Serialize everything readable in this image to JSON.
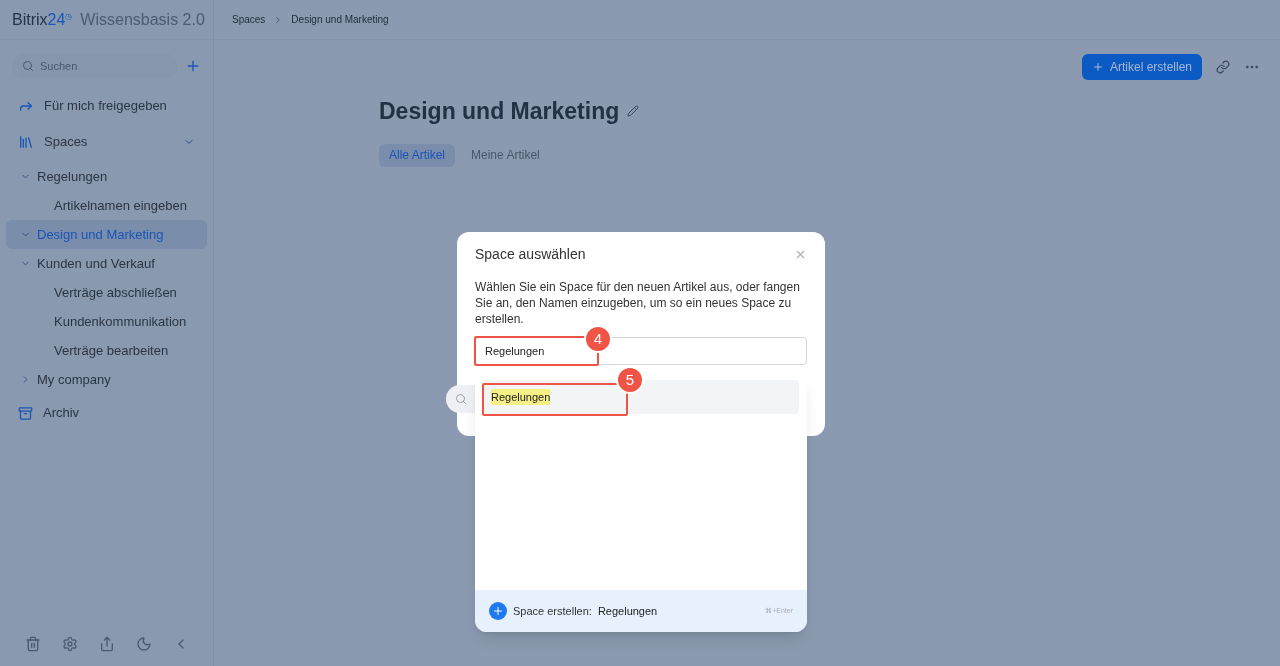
{
  "sidebar": {
    "logo": {
      "brand": "Bitrix",
      "number": "24",
      "mark": "◷"
    },
    "app_title": "Wissensbasis 2.0",
    "search": {
      "placeholder": "Suchen"
    },
    "nav": [
      {
        "kind": "link",
        "label": "Für mich freigegeben"
      },
      {
        "kind": "section",
        "label": "Spaces",
        "expanded": true
      }
    ],
    "tree": [
      {
        "label": "Regelungen",
        "expanded": true,
        "selected": false,
        "children": [
          {
            "label": "Artikelnamen eingeben",
            "selected": false
          }
        ]
      },
      {
        "label": "Design und Marketing",
        "expanded": true,
        "selected": true
      },
      {
        "label": "Kunden und Verkauf",
        "expanded": true,
        "selected": false,
        "children": [
          {
            "label": "Verträge abschließen",
            "selected": false
          },
          {
            "label": "Kundenkommunikation",
            "selected": false
          },
          {
            "label": "Verträge bearbeiten",
            "selected": false
          }
        ]
      },
      {
        "label": "My company",
        "expanded": false,
        "selected": false
      }
    ],
    "archive": "Archiv"
  },
  "breadcrumb": [
    "Spaces",
    "Design und Marketing"
  ],
  "create_button": "Artikel erstellen",
  "page": {
    "title": "Design und Marketing",
    "tabs": [
      {
        "label": "Alle Artikel",
        "selected": true
      },
      {
        "label": "Meine Artikel",
        "selected": false
      }
    ]
  },
  "dialog": {
    "title": "Space auswählen",
    "text": "Wählen Sie ein Space für den neuen Artikel aus, oder fangen Sie an, den Namen einzugeben, um so ein neues Space zu erstellen.",
    "input": {
      "value": "Regelungen"
    },
    "results": [
      {
        "label": "Regelungen",
        "selected": true
      }
    ],
    "footer": {
      "label": "Space erstellen:",
      "value": "Regelungen",
      "shortcut": "⌘+Enter"
    }
  },
  "annotations": [
    {
      "number": "4"
    },
    {
      "number": "5"
    }
  ]
}
